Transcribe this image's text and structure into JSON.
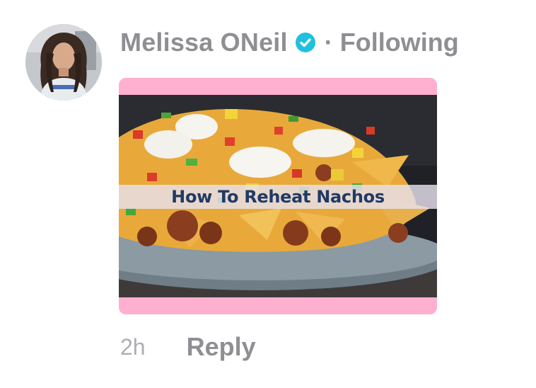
{
  "comment": {
    "author_name": "Melissa ONeil",
    "separator": "·",
    "follow_status": "Following",
    "timestamp": "2h",
    "reply_label": "Reply",
    "verified_icon": "verified-check-icon",
    "avatar_icon": "avatar-photo"
  },
  "media": {
    "caption": "How To Reheat Nachos",
    "frame_color": "#ffafcf"
  },
  "colors": {
    "text_secondary": "#8e8e93",
    "timestamp": "#aeaeb2",
    "verified_badge": "#20c0de"
  }
}
